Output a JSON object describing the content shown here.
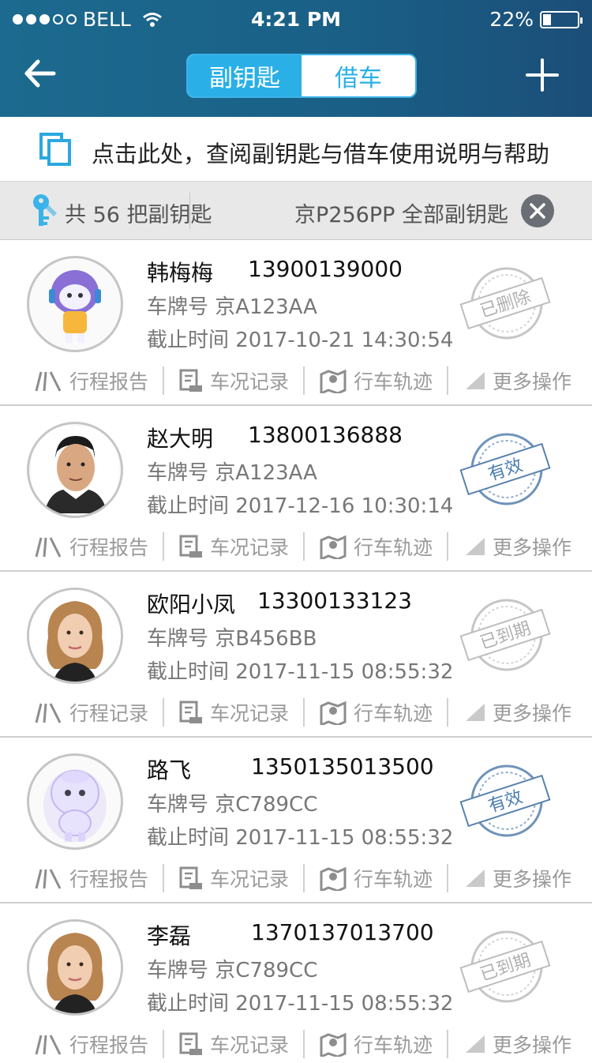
{
  "status": {
    "carrier": "BELL",
    "time": "4:21 PM",
    "battery": "22%"
  },
  "header": {
    "tab_left": "副钥匙",
    "tab_right": "借车"
  },
  "help": {
    "text": "点击此处，查阅副钥匙与借车使用说明与帮助"
  },
  "summary": {
    "count_text": "共 56 把副钥匙",
    "filter_text": "京P256PP 全部副钥匙"
  },
  "colors": {
    "accent": "#2ab0e6",
    "header": "#1a5f86",
    "stamp_valid": "#4a7db0",
    "stamp_gray": "#b9b9b9"
  },
  "items": [
    {
      "name": "韩梅梅",
      "phone": "13900139000",
      "plate": "车牌号 京A123AA",
      "expire": "截止时间 2017-10-21 14:30:54",
      "stamp": "已删除",
      "action1": "行程报告",
      "action2": "车况记录",
      "action3": "行车轨迹",
      "action4": "更多操作"
    },
    {
      "name": "赵大明",
      "phone": "13800136888",
      "plate": "车牌号 京A123AA",
      "expire": "截止时间 2017-12-16 10:30:14",
      "stamp": "有效",
      "action1": "行程报告",
      "action2": "车况记录",
      "action3": "行车轨迹",
      "action4": "更多操作"
    },
    {
      "name": "欧阳小凤",
      "phone": "13300133123",
      "plate": "车牌号 京B456BB",
      "expire": "截止时间 2017-11-15 08:55:32",
      "stamp": "已到期",
      "action1": "行程记录",
      "action2": "车况记录",
      "action3": "行车轨迹",
      "action4": "更多操作"
    },
    {
      "name": "路飞",
      "phone": "1350135013500",
      "plate": "车牌号 京C789CC",
      "expire": "截止时间 2017-11-15 08:55:32",
      "stamp": "有效",
      "action1": "行程报告",
      "action2": "车况记录",
      "action3": "行车轨迹",
      "action4": "更多操作"
    },
    {
      "name": "李磊",
      "phone": "1370137013700",
      "plate": "车牌号 京C789CC",
      "expire": "截止时间 2017-11-15 08:55:32",
      "stamp": "已到期",
      "action1": "行程报告",
      "action2": "车况记录",
      "action3": "行车轨迹",
      "action4": "更多操作"
    }
  ]
}
